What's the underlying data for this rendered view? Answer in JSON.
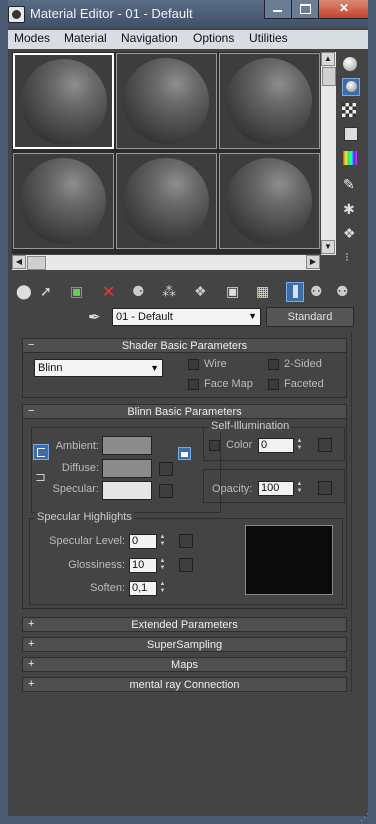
{
  "window": {
    "title": "Material Editor - 01 - Default"
  },
  "menu": [
    "Modes",
    "Material",
    "Navigation",
    "Options",
    "Utilities"
  ],
  "material_name": "01 - Default",
  "material_type_button": "Standard",
  "shader_basic": {
    "header": "Shader Basic Parameters",
    "shader": "Blinn",
    "checks": [
      "Wire",
      "2-Sided",
      "Face Map",
      "Faceted"
    ]
  },
  "blinn_basic": {
    "header": "Blinn Basic Parameters",
    "self_illum_title": "Self-Illumination",
    "color_label": "Color",
    "color_value": "0",
    "ambient_label": "Ambient:",
    "diffuse_label": "Diffuse:",
    "specular_label": "Specular:",
    "opacity_label": "Opacity:",
    "opacity_value": "100",
    "colors": {
      "ambient": "#8c8c8c",
      "diffuse": "#8c8c8c",
      "specular": "#e6e6e6"
    }
  },
  "specular_highlights": {
    "title": "Specular Highlights",
    "level_label": "Specular Level:",
    "level_value": "0",
    "gloss_label": "Glossiness:",
    "gloss_value": "10",
    "soften_label": "Soften:",
    "soften_value": "0,1"
  },
  "collapsed_rollouts": [
    "Extended Parameters",
    "SuperSampling",
    "Maps",
    "mental ray Connection"
  ],
  "side_icons": [
    "sample-type-icon",
    "backlight-icon",
    "background-icon",
    "sample-uv-tiling-icon",
    "video-color-check-icon",
    "make-preview-icon",
    "options-icon",
    "select-by-material-icon",
    "material-map-navigator-icon"
  ],
  "toolbar_icons": [
    "get-material-icon",
    "put-to-scene-icon",
    "assign-to-selection-icon",
    "reset-map-icon",
    "copy-material-icon",
    "make-unique-icon",
    "put-to-library-icon",
    "material-id-channel-icon",
    "show-map-in-viewport-icon",
    "show-end-result-icon",
    "go-to-parent-icon",
    "go-forward-to-sibling-icon"
  ]
}
